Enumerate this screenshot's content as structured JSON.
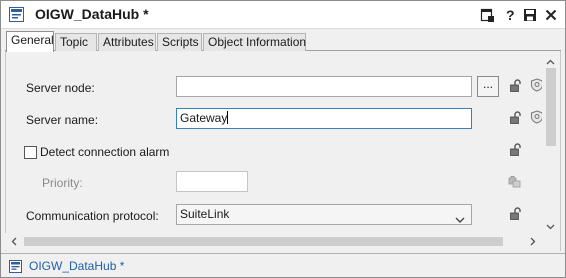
{
  "window": {
    "title": "OIGW_DataHub *",
    "app_icon": "object-editor-icon",
    "title_buttons": [
      "dock-icon",
      "help-icon",
      "save-icon",
      "close-icon"
    ]
  },
  "tabs": [
    {
      "label": "General",
      "active": true
    },
    {
      "label": "Topic",
      "active": false
    },
    {
      "label": "Attributes",
      "active": false
    },
    {
      "label": "Scripts",
      "active": false
    },
    {
      "label": "Object Information",
      "active": false
    }
  ],
  "form": {
    "server_node": {
      "label": "Server node:",
      "value": "",
      "browse_label": "..."
    },
    "server_name": {
      "label": "Server name:",
      "value": "Gateway"
    },
    "detect_alarm": {
      "label": "Detect connection alarm",
      "checked": false
    },
    "priority": {
      "label": "Priority:",
      "value": "",
      "enabled": false
    },
    "protocol": {
      "label": "Communication protocol:",
      "value": "SuiteLink"
    }
  },
  "status": {
    "text": "OIGW_DataHub *",
    "icon": "object-editor-icon"
  },
  "colors": {
    "link_blue": "#1f5fa8",
    "focus_border": "#3c7fb1",
    "window_bg": "#f0f0f0"
  }
}
